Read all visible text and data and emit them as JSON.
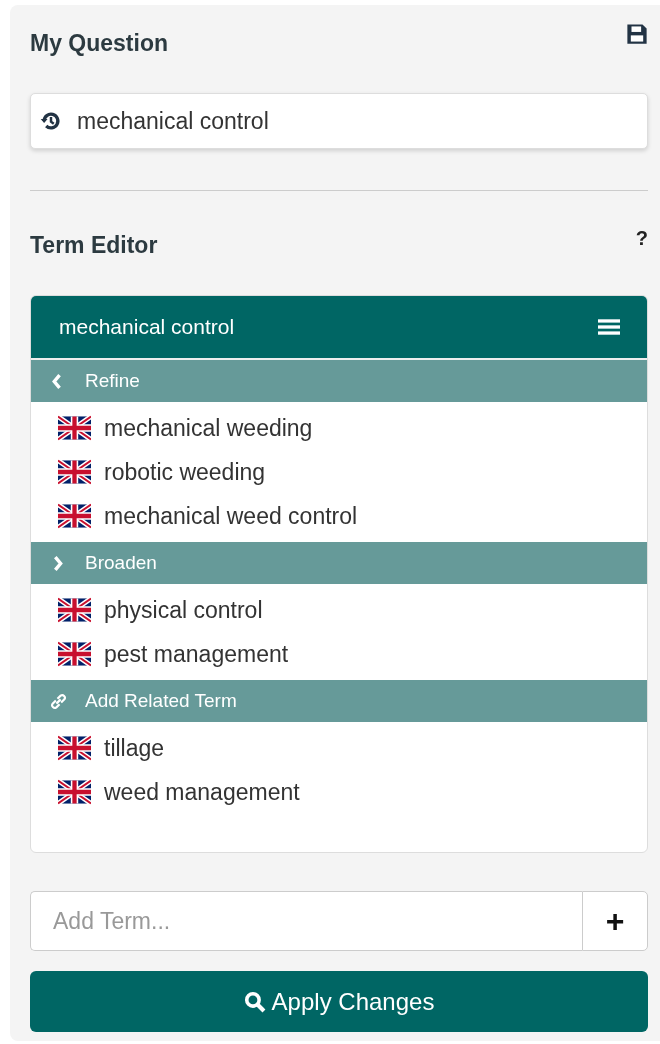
{
  "question": {
    "title": "My Question",
    "value": "mechanical control"
  },
  "term_editor": {
    "title": "Term Editor",
    "help": "?",
    "current_term": "mechanical control",
    "sections": [
      {
        "kind": "refine",
        "label": "Refine",
        "terms": [
          "mechanical weeding",
          "robotic weeding",
          "mechanical weed control"
        ]
      },
      {
        "kind": "broaden",
        "label": "Broaden",
        "terms": [
          "physical control",
          "pest management"
        ]
      },
      {
        "kind": "related",
        "label": "Add Related Term",
        "terms": [
          "tillage",
          "weed management"
        ]
      }
    ]
  },
  "add_term": {
    "placeholder": "Add Term...",
    "button": "+"
  },
  "apply_button": "Apply Changes"
}
